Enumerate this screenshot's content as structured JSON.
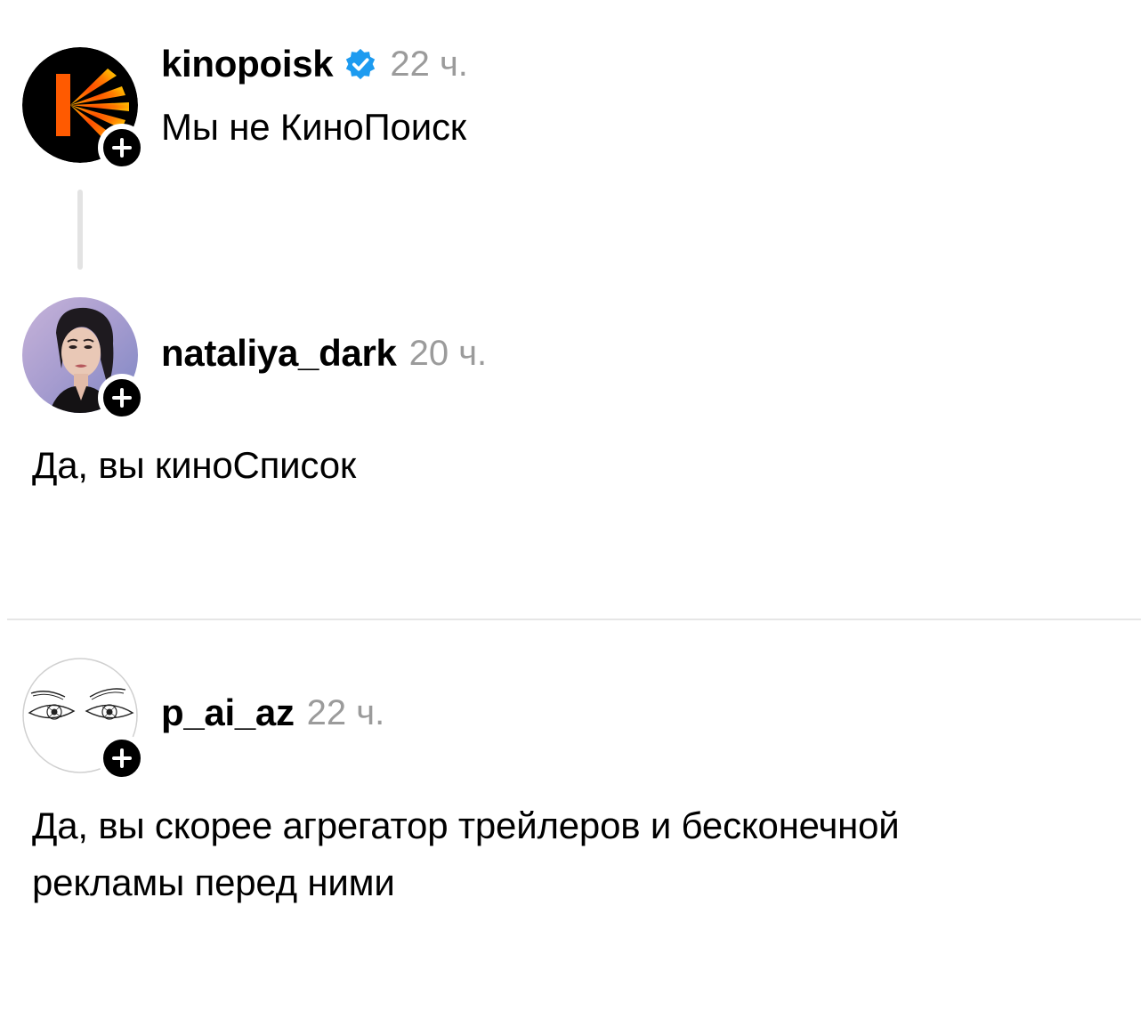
{
  "posts": [
    {
      "username": "kinopoisk",
      "verified": true,
      "time": "22 ч.",
      "text": "Мы не КиноПоиск",
      "avatar_icon": "kinopoisk-logo-icon"
    },
    {
      "username": "nataliya_dark",
      "verified": false,
      "time": "20 ч.",
      "text": "Да, вы киноСписок",
      "avatar_icon": "profile-photo-icon"
    },
    {
      "username": "p_ai_az",
      "verified": false,
      "time": "22 ч.",
      "text_lines": [
        "Да, вы скорее агрегатор трейлеров и бесконечной",
        "рекламы перед ними"
      ],
      "avatar_icon": "eyes-drawing-icon"
    }
  ],
  "colors": {
    "time": "#9b9b9b",
    "verified": "#1d9bf0",
    "kinopoisk_orange": "#ff5500",
    "divider": "#e6e6e6",
    "thread_line": "#e3e3e3"
  }
}
